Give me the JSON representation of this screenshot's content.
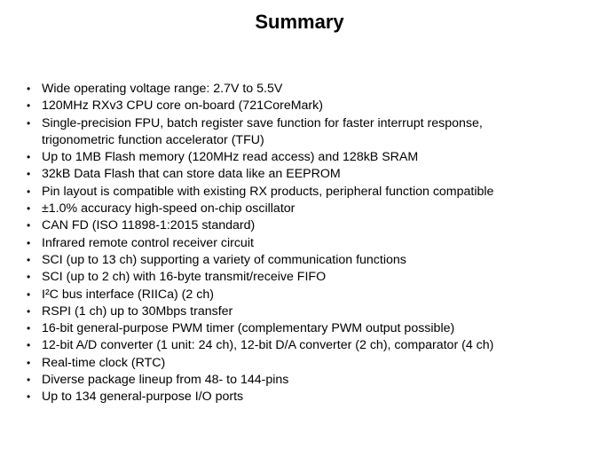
{
  "slide": {
    "title": "Summary",
    "bullet_glyph": "•",
    "items": [
      {
        "text": "Wide operating voltage range: 2.7V to 5.5V"
      },
      {
        "text": "120MHz RXv3 CPU core on-board (721CoreMark)"
      },
      {
        "text": "Single-precision FPU, batch register save function for faster interrupt response,",
        "continuation": "trigonometric function accelerator (TFU)"
      },
      {
        "text": "Up to 1MB Flash memory (120MHz read access) and 128kB SRAM"
      },
      {
        "text": "32kB Data Flash that can store data like an EEPROM"
      },
      {
        "text": "Pin layout is compatible with existing RX products, peripheral function  compatible"
      },
      {
        "text": "±1.0% accuracy high-speed on-chip oscillator"
      },
      {
        "text": "CAN FD (ISO 11898-1:2015 standard)"
      },
      {
        "text": "Infrared remote control receiver circuit"
      },
      {
        "text": "SCI (up to 13 ch) supporting a variety of communication functions"
      },
      {
        "text": "SCI (up to 2 ch) with 16-byte transmit/receive FIFO"
      },
      {
        "text": "I²C bus interface (RIICa) (2 ch)"
      },
      {
        "text": "RSPI (1 ch) up to 30Mbps transfer"
      },
      {
        "text": "16-bit general-purpose PWM timer (complementary PWM output possible)"
      },
      {
        "text": "12-bit A/D converter (1 unit: 24 ch), 12-bit D/A converter (2 ch), comparator (4 ch)"
      },
      {
        "text": "Real-time clock (RTC)"
      },
      {
        "text": "Diverse package lineup from 48- to 144-pins"
      },
      {
        "text": "Up to 134 general-purpose I/O ports"
      }
    ]
  }
}
